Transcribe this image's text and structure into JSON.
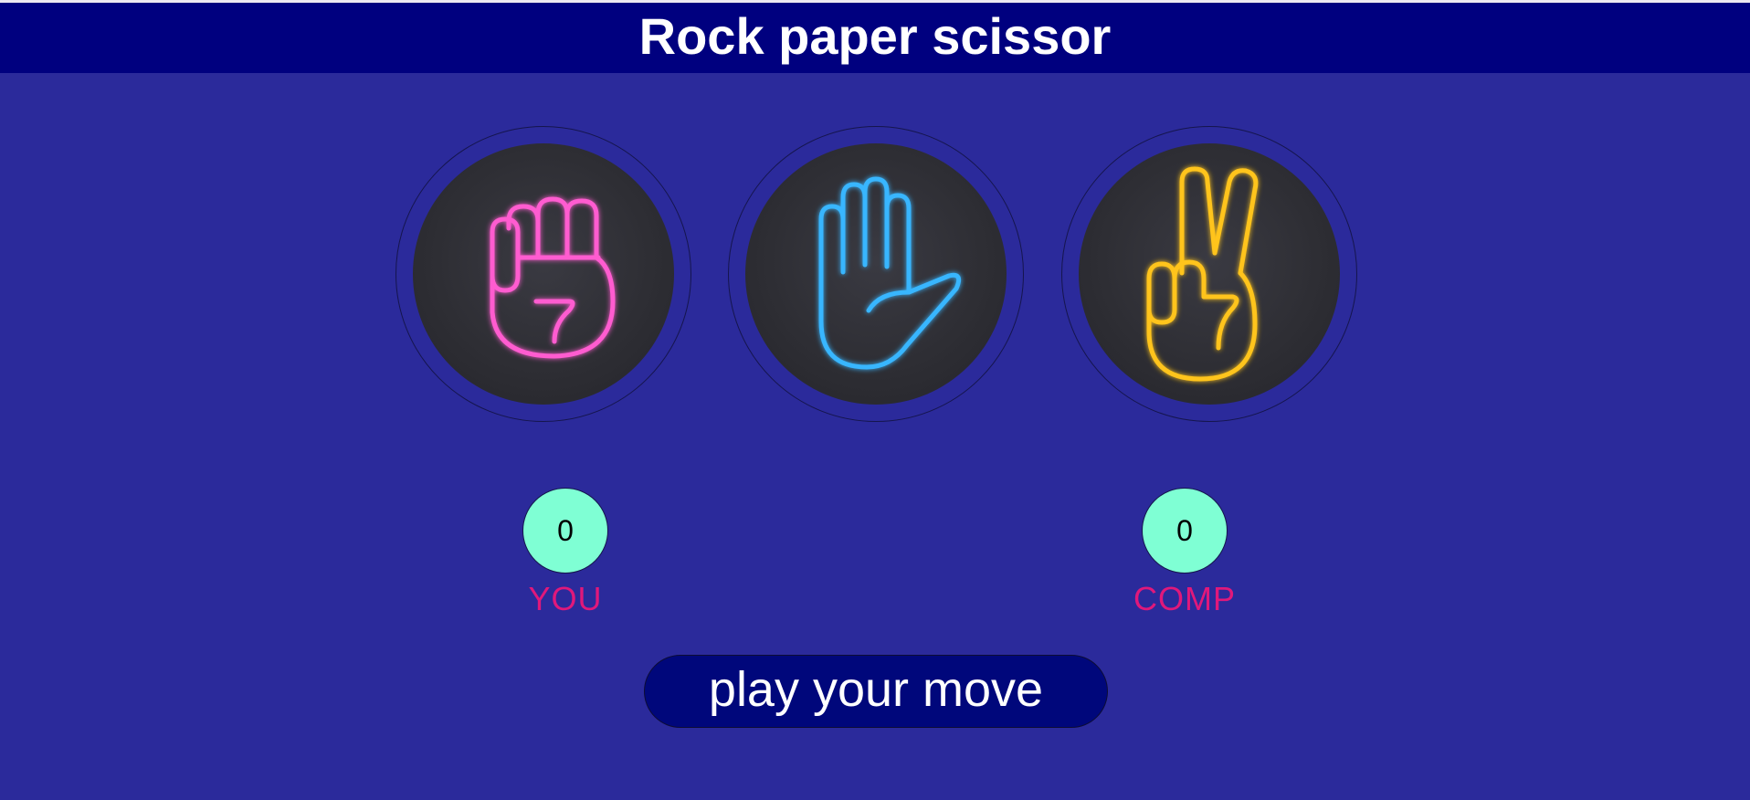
{
  "app": {
    "title": "Rock paper scissor"
  },
  "choices": [
    {
      "name": "rock",
      "icon": "neon-fist-icon",
      "glow_color": "#ff5bd0"
    },
    {
      "name": "paper",
      "icon": "neon-open-hand-icon",
      "glow_color": "#39b6ff"
    },
    {
      "name": "scissor",
      "icon": "neon-peace-sign-icon",
      "glow_color": "#ffc41a"
    }
  ],
  "scoreboard": {
    "user": {
      "score": "0",
      "label": "YOU"
    },
    "computer": {
      "score": "0",
      "label": "COMP"
    }
  },
  "message": {
    "text": "play your move"
  },
  "colors": {
    "background": "#2b2a9b",
    "header": "#00007f",
    "score_circle": "#7fffd4",
    "score_label": "#e0187b",
    "message_bg": "#00077b"
  }
}
